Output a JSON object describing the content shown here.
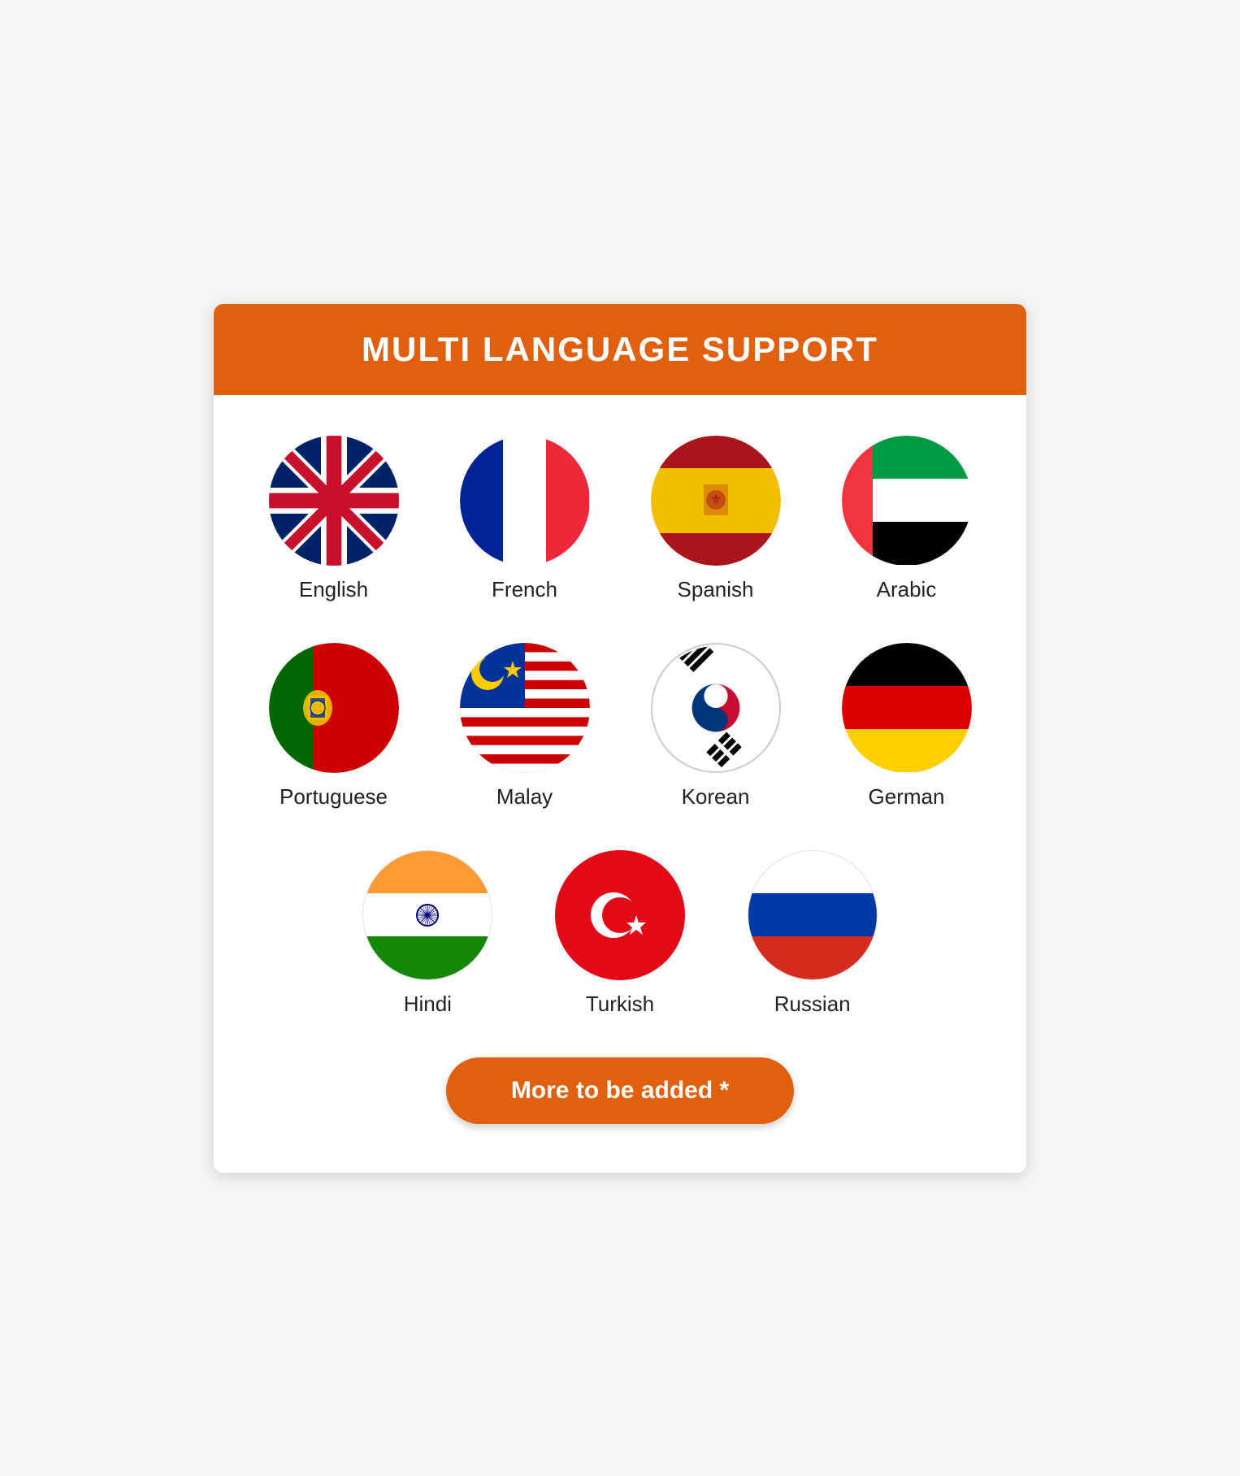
{
  "header": {
    "title": "MULTI LANGUAGE SUPPORT"
  },
  "languages_row1": [
    {
      "id": "english",
      "label": "English",
      "flag": "uk"
    },
    {
      "id": "french",
      "label": "French",
      "flag": "fr"
    },
    {
      "id": "spanish",
      "label": "Spanish",
      "flag": "es"
    },
    {
      "id": "arabic",
      "label": "Arabic",
      "flag": "ae"
    }
  ],
  "languages_row2": [
    {
      "id": "portuguese",
      "label": "Portuguese",
      "flag": "pt"
    },
    {
      "id": "malay",
      "label": "Malay",
      "flag": "my"
    },
    {
      "id": "korean",
      "label": "Korean",
      "flag": "kr"
    },
    {
      "id": "german",
      "label": "German",
      "flag": "de"
    }
  ],
  "languages_row3": [
    {
      "id": "hindi",
      "label": "Hindi",
      "flag": "in"
    },
    {
      "id": "turkish",
      "label": "Turkish",
      "flag": "tr"
    },
    {
      "id": "russian",
      "label": "Russian",
      "flag": "ru"
    }
  ],
  "more_button": {
    "label": "More to be added *"
  }
}
